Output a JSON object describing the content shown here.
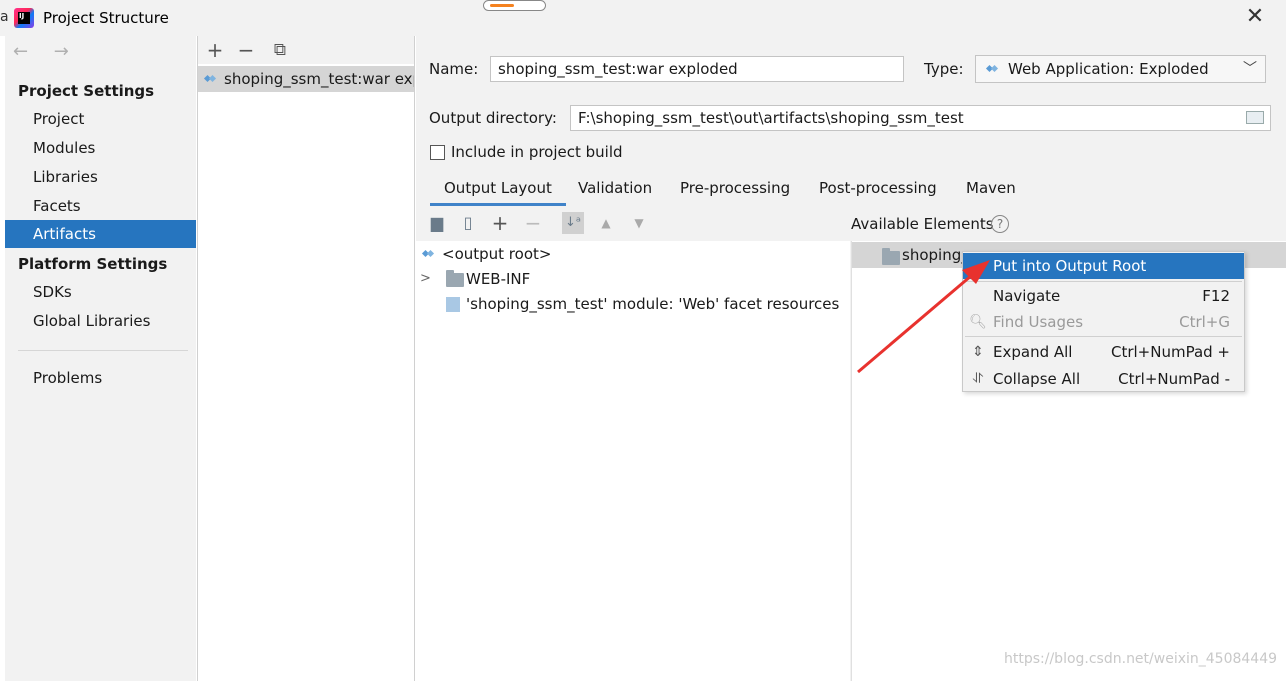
{
  "window": {
    "title": "Project Structure",
    "left_edge_char": "a",
    "close_label": "✕"
  },
  "nav": {
    "back_forward": "← →",
    "project_settings_header": "Project Settings",
    "project_settings_items": [
      "Project",
      "Modules",
      "Libraries",
      "Facets",
      "Artifacts"
    ],
    "selected": "Artifacts",
    "platform_settings_header": "Platform Settings",
    "platform_settings_items": [
      "SDKs",
      "Global Libraries"
    ],
    "problems": "Problems"
  },
  "artifacts_list": {
    "toolbar": [
      "+",
      "−",
      "⧉"
    ],
    "items": [
      "shoping_ssm_test:war exploded"
    ],
    "visible_text": "shoping_ssm_test:war expl"
  },
  "form": {
    "name_label": "Name:",
    "name_value": "shoping_ssm_test:war exploded",
    "type_label": "Type:",
    "type_value": "Web Application: Exploded",
    "output_dir_label": "Output directory:",
    "output_dir_value": "F:\\shoping_ssm_test\\out\\artifacts\\shoping_ssm_test",
    "include_label": "Include in project build",
    "include_checked": false
  },
  "tabs": [
    "Output Layout",
    "Validation",
    "Pre-processing",
    "Post-processing",
    "Maven"
  ],
  "active_tab": "Output Layout",
  "layout_tree": {
    "root": "<output root>",
    "children": [
      "WEB-INF",
      "'shoping_ssm_test' module: 'Web' facet resources"
    ]
  },
  "available": {
    "header": "Available Elements",
    "help": "?",
    "row_text": "shoping_"
  },
  "context_menu": {
    "items": [
      {
        "label": "Put into Output Root",
        "shortcut": "",
        "highlighted": true,
        "disabled": false
      },
      {
        "label": "Navigate",
        "shortcut": "F12",
        "highlighted": false,
        "disabled": false
      },
      {
        "label": "Find Usages",
        "shortcut": "Ctrl+G",
        "highlighted": false,
        "disabled": true
      },
      {
        "label": "Expand All",
        "shortcut": "Ctrl+NumPad +",
        "highlighted": false,
        "disabled": false
      },
      {
        "label": "Collapse All",
        "shortcut": "Ctrl+NumPad -",
        "highlighted": false,
        "disabled": false
      }
    ]
  },
  "watermark": "https://blog.csdn.net/weixin_45084449",
  "colors": {
    "selection": "#2675bf",
    "accent_arrow": "#e8322e",
    "panel_bg": "#f2f2f2"
  }
}
